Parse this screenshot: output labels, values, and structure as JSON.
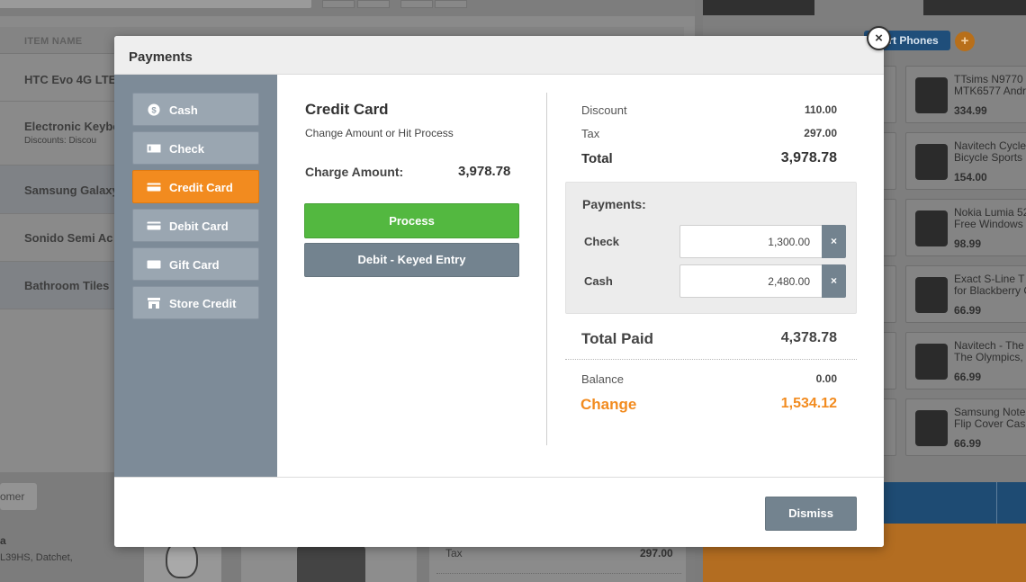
{
  "background": {
    "column_header": "ITEM NAME",
    "rows": [
      {
        "name": "HTC Evo 4G LTE"
      },
      {
        "name": "Electronic Keybo",
        "sub": "Discounts:   Discou"
      },
      {
        "name": "Samsung Galaxy"
      },
      {
        "name": "Sonido Semi Ac"
      },
      {
        "name": "Bathroom Tiles"
      }
    ],
    "customer_button": "omer",
    "customer_name": "a",
    "customer_address": "L39HS, Datchet,",
    "tax_label": "Tax",
    "tax_value": "297.00",
    "category_button": "urt Phones",
    "add_icon": "+",
    "products": [
      {
        "name": "TTsims N9770\nMTK6577 Andr",
        "price": "334.99"
      },
      {
        "name": "Navitech Cycle\nBicycle Sports",
        "price": "154.00"
      },
      {
        "name": "Nokia Lumia 52\nFree Windows",
        "price": "98.99"
      },
      {
        "name": "Exact S-Line T\nfor Blackberry C",
        "price": "66.99"
      },
      {
        "name": "Navitech - The\nThe Olympics,",
        "price": "66.99"
      },
      {
        "name": "Samsung Note\nFlip Cover Cas",
        "price": "66.99"
      }
    ]
  },
  "modal": {
    "title": "Payments",
    "close_glyph": "×",
    "tenders": [
      {
        "label": "Cash",
        "icon": "dollar-icon"
      },
      {
        "label": "Check",
        "icon": "check-icon"
      },
      {
        "label": "Credit Card",
        "icon": "credit-card-icon",
        "active": true
      },
      {
        "label": "Debit Card",
        "icon": "debit-card-icon"
      },
      {
        "label": "Gift Card",
        "icon": "gift-card-icon"
      },
      {
        "label": "Store Credit",
        "icon": "store-icon"
      }
    ],
    "tender_panel": {
      "title": "Credit Card",
      "subtitle": "Change Amount or Hit Process",
      "charge_label": "Charge Amount:",
      "charge_value": "3,978.78",
      "process_label": "Process",
      "debit_label": "Debit - Keyed Entry"
    },
    "summary": {
      "discount_label": "Discount",
      "discount_value": "110.00",
      "tax_label": "Tax",
      "tax_value": "297.00",
      "total_label": "Total",
      "total_value": "3,978.78"
    },
    "payments": {
      "label": "Payments:",
      "lines": [
        {
          "label": "Check",
          "amount": "1,300.00"
        },
        {
          "label": "Cash",
          "amount": "2,480.00"
        }
      ],
      "remove_glyph": "×"
    },
    "totals": {
      "paid_label": "Total Paid",
      "paid_value": "4,378.78",
      "balance_label": "Balance",
      "balance_value": "0.00",
      "change_label": "Change",
      "change_value": "1,534.12"
    },
    "dismiss_label": "Dismiss"
  },
  "colors": {
    "accent_orange": "#f28b1f",
    "process_green": "#53b840",
    "slate_button": "#73838f",
    "sidebar": "#7d8b98"
  }
}
